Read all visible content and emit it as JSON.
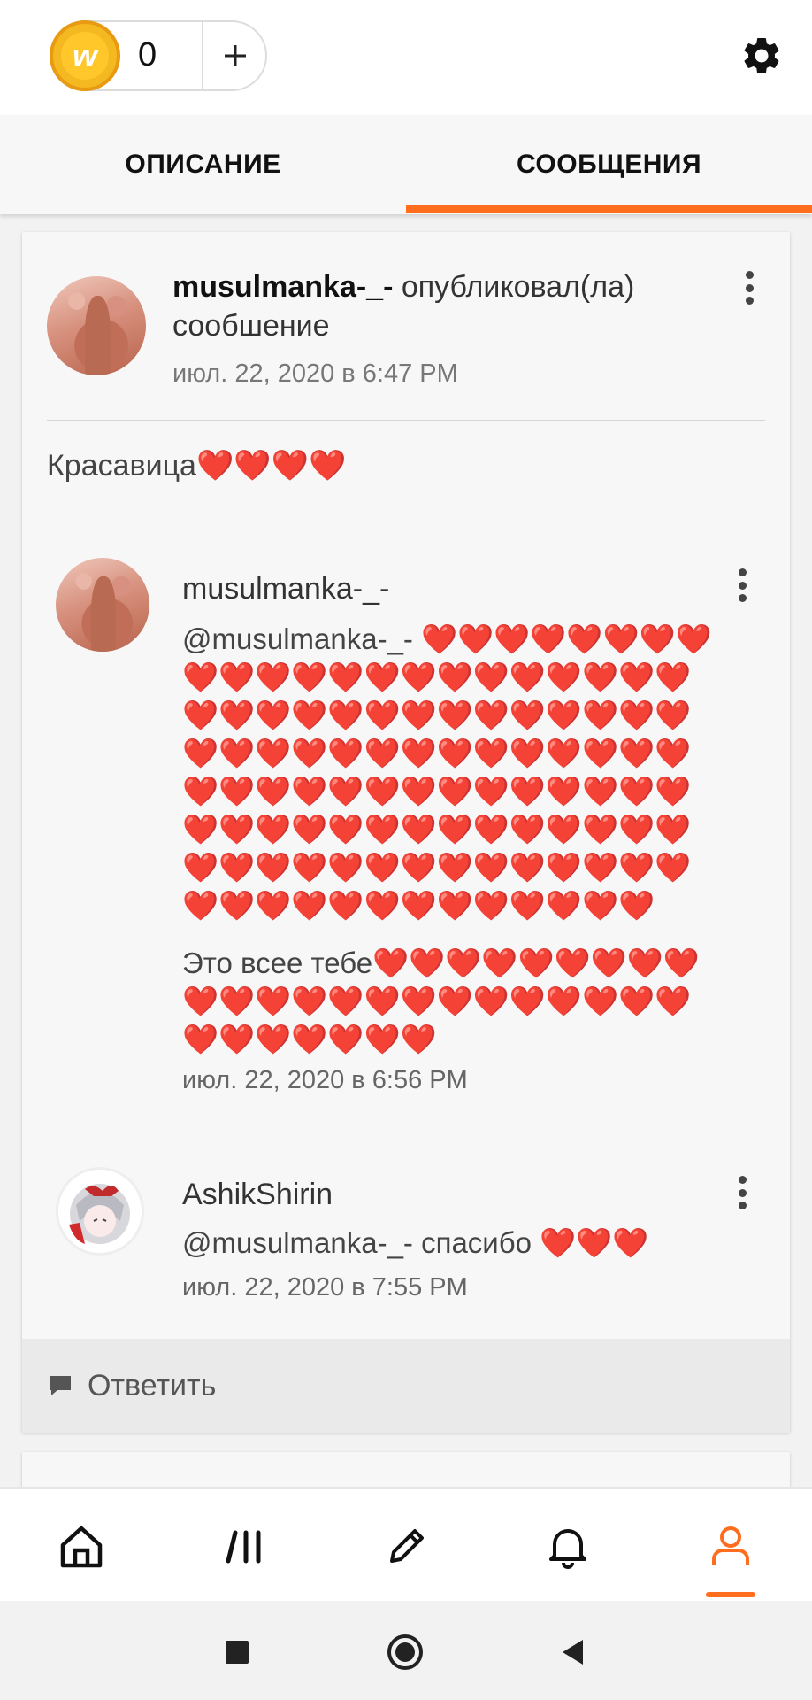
{
  "topbar": {
    "coin_letter": "w",
    "coin_count": "0",
    "plus_icon": "plus-icon",
    "settings_icon": "gear-icon"
  },
  "tabs": [
    {
      "label": "ОПИСАНИЕ",
      "active": false
    },
    {
      "label": "СООБЩЕНИЯ",
      "active": true
    }
  ],
  "post": {
    "author": "musulmanka-_-",
    "action": "опубликовал(ла) сообшение",
    "date": "июл. 22, 2020 в 6:47 PM",
    "body": "Красавица❤️❤️❤️❤️"
  },
  "replies": [
    {
      "author": "musulmanka-_-",
      "text_line1": "@musulmanka-_-  ❤️❤️❤️❤️❤️❤️❤️❤️",
      "text_line2": "❤️❤️❤️❤️❤️❤️❤️❤️❤️❤️❤️❤️❤️❤️",
      "text_line3": "❤️❤️❤️❤️❤️❤️❤️❤️❤️❤️❤️❤️❤️❤️",
      "text_line4": "❤️❤️❤️❤️❤️❤️❤️❤️❤️❤️❤️❤️❤️❤️",
      "text_line5": "❤️❤️❤️❤️❤️❤️❤️❤️❤️❤️❤️❤️❤️❤️",
      "text_line6": "❤️❤️❤️❤️❤️❤️❤️❤️❤️❤️❤️❤️❤️❤️",
      "text_line7": "❤️❤️❤️❤️❤️❤️❤️❤️❤️❤️❤️❤️❤️❤️",
      "text_line8": "❤️❤️❤️❤️❤️❤️❤️❤️❤️❤️❤️❤️❤️",
      "text2_line1": "Это всее тебе❤️❤️❤️❤️❤️❤️❤️❤️❤️",
      "text2_line2": "❤️❤️❤️❤️❤️❤️❤️❤️❤️❤️❤️❤️❤️❤️",
      "text2_line3": "❤️❤️❤️❤️❤️❤️❤️",
      "date": "июл. 22, 2020 в 6:56 PM"
    },
    {
      "author": "AshikShirin",
      "text": "@musulmanka-_-  спасибо ❤️❤️❤️",
      "date": "июл. 22, 2020 в 7:55 PM"
    }
  ],
  "reply_button": "Ответить",
  "bottom_nav": [
    {
      "icon": "home-icon",
      "active": false
    },
    {
      "icon": "library-icon",
      "active": false
    },
    {
      "icon": "pencil-icon",
      "active": false
    },
    {
      "icon": "bell-icon",
      "active": false
    },
    {
      "icon": "profile-icon",
      "active": true
    }
  ],
  "colors": {
    "accent": "#ff6d1f",
    "heart": "#f2877a",
    "coin": "#f4b820"
  }
}
